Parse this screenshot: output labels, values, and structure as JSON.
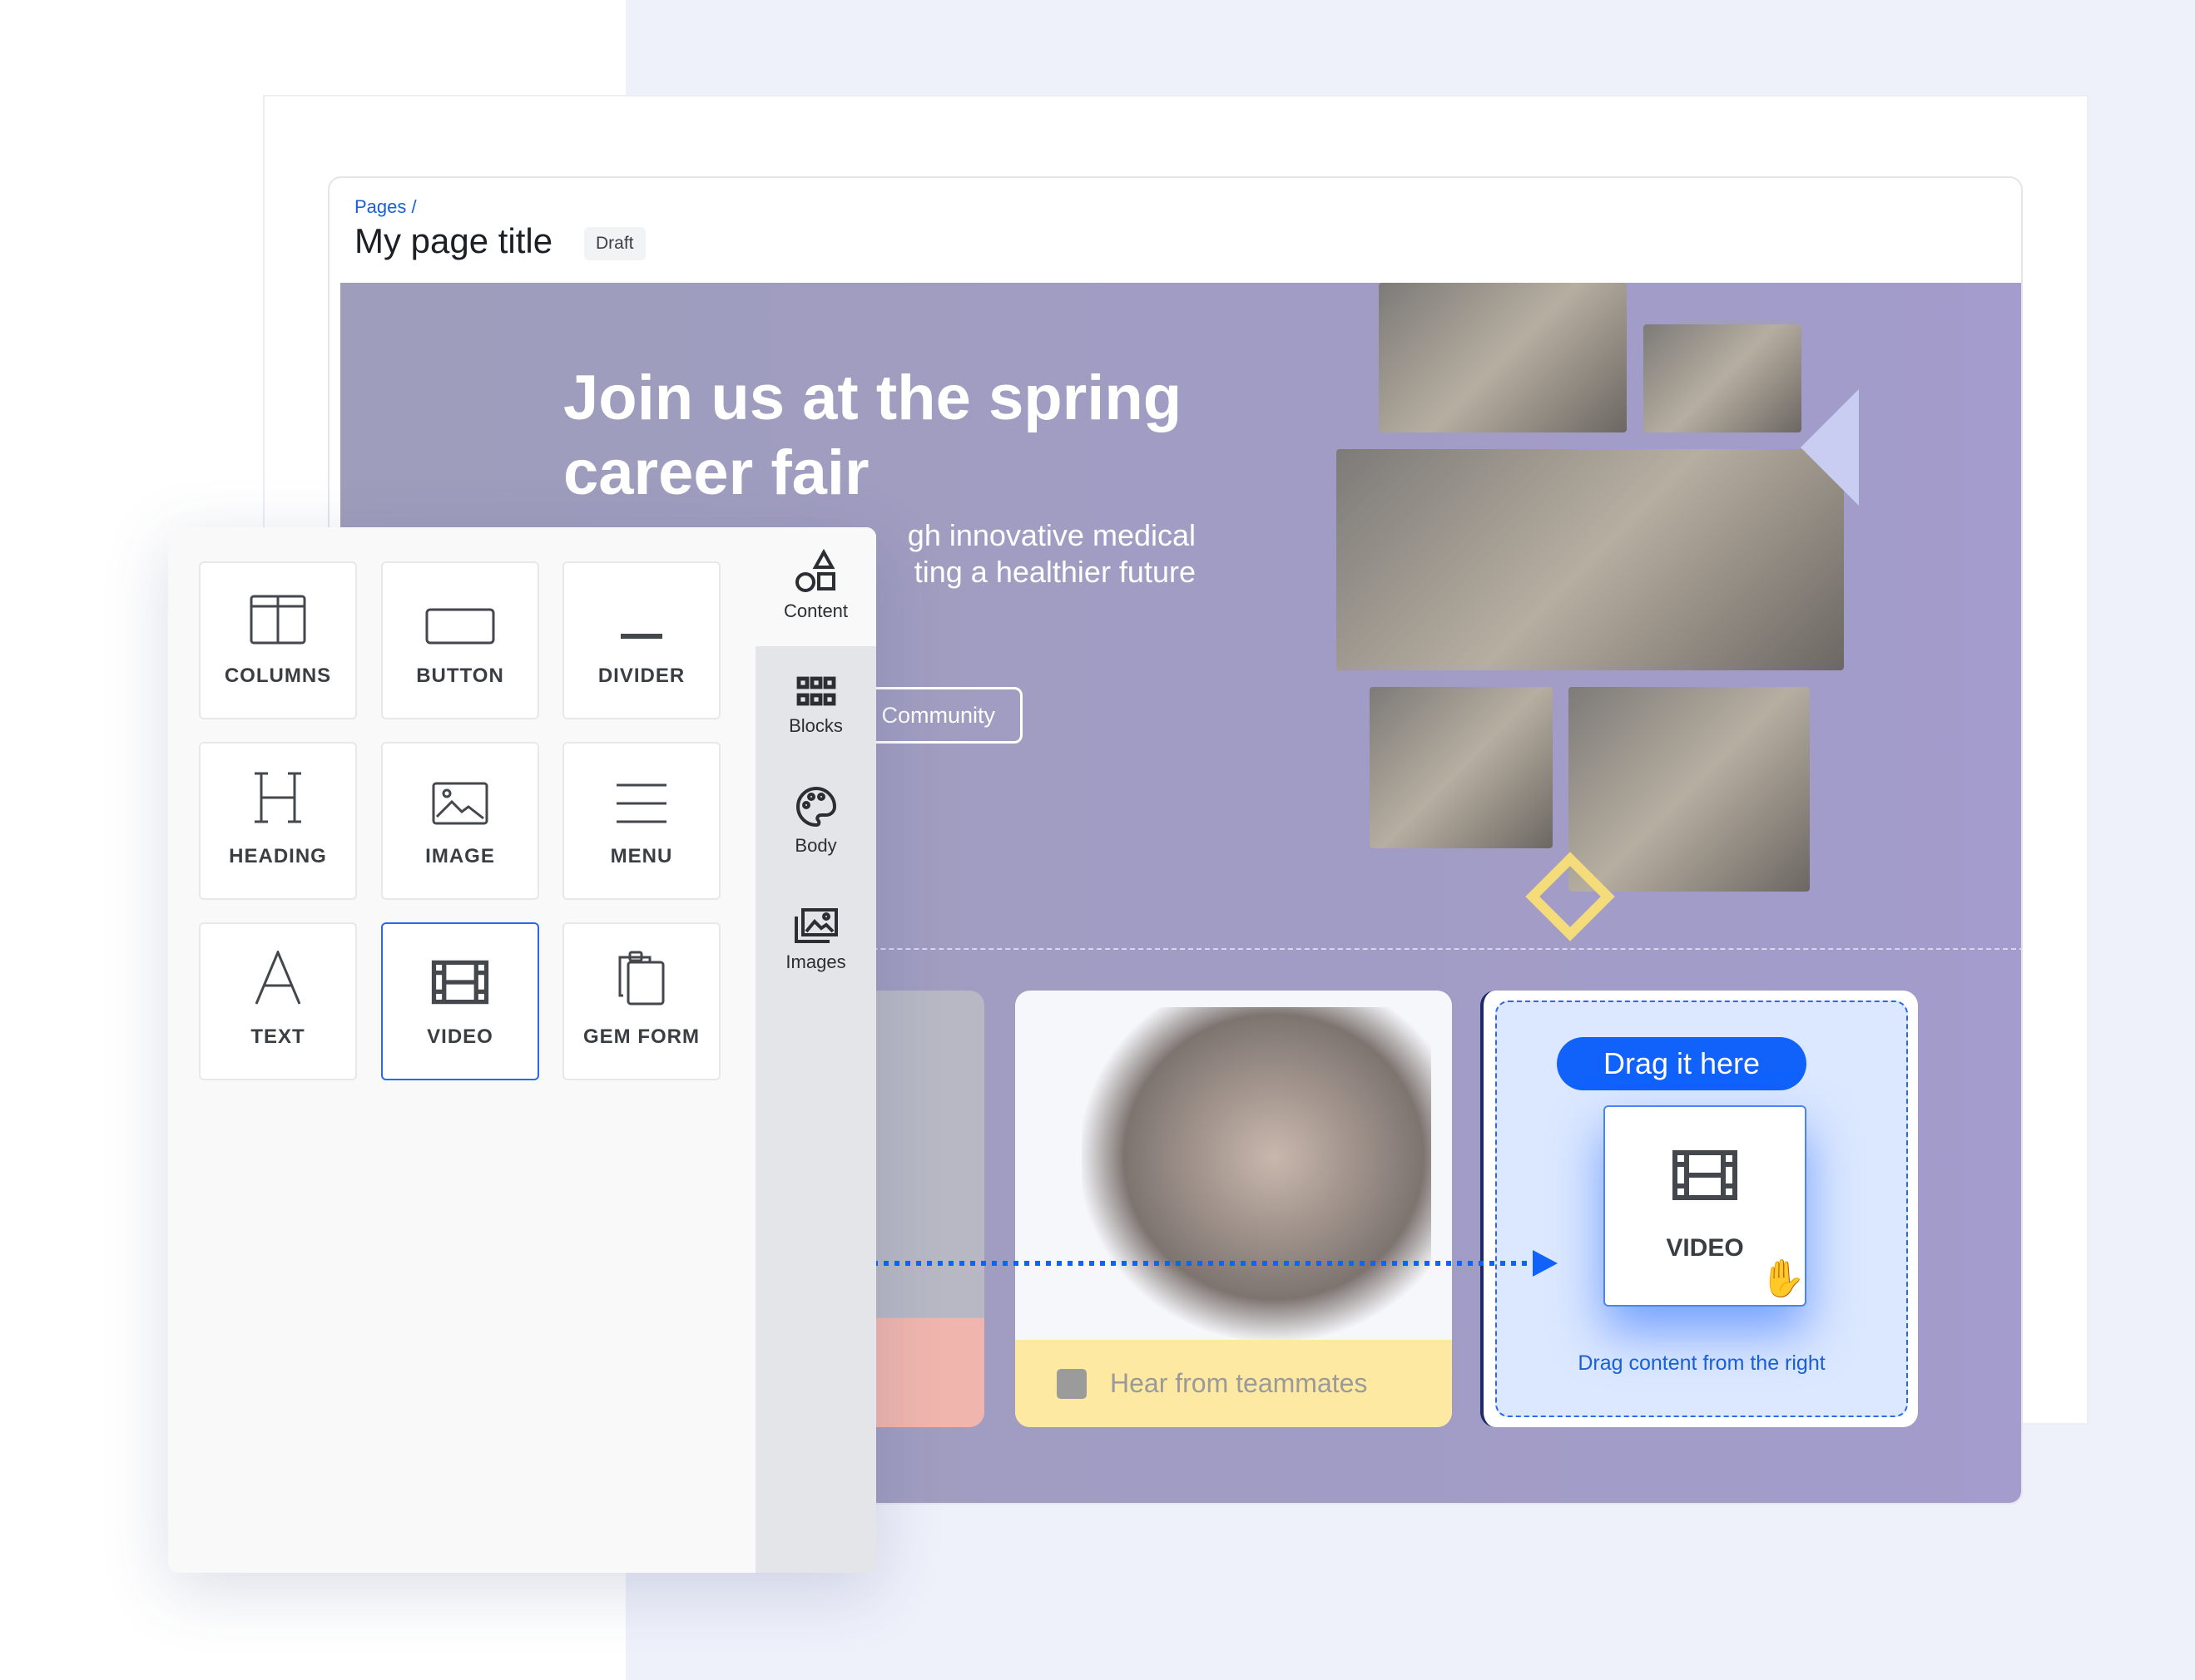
{
  "header": {
    "breadcrumb": "Pages /",
    "title": "My page title",
    "status": "Draft"
  },
  "hero": {
    "heading": "Join us at the spring career fair",
    "subtitle_visible": "gh innovative medical\nting a healthier future",
    "cta_visible": "t Community"
  },
  "cards": {
    "teammates_label": "Hear from teammates"
  },
  "dropzone": {
    "pill": "Drag it here",
    "tile_label": "VIDEO",
    "hint": "Drag content from the right"
  },
  "panel": {
    "tabs": [
      {
        "label": "Content",
        "icon": "shapes-icon"
      },
      {
        "label": "Blocks",
        "icon": "grid-icon"
      },
      {
        "label": "Body",
        "icon": "palette-icon"
      },
      {
        "label": "Images",
        "icon": "images-icon"
      }
    ],
    "active_tab": "Content",
    "tiles": [
      {
        "label": "COLUMNS"
      },
      {
        "label": "BUTTON"
      },
      {
        "label": "DIVIDER"
      },
      {
        "label": "HEADING"
      },
      {
        "label": "IMAGE"
      },
      {
        "label": "MENU"
      },
      {
        "label": "TEXT"
      },
      {
        "label": "VIDEO"
      },
      {
        "label": "GEM FORM"
      }
    ],
    "selected_tile": "VIDEO"
  },
  "colors": {
    "accent": "#1062fb",
    "hero": "#a09ec4",
    "teammates_bg": "#fde9a1"
  }
}
